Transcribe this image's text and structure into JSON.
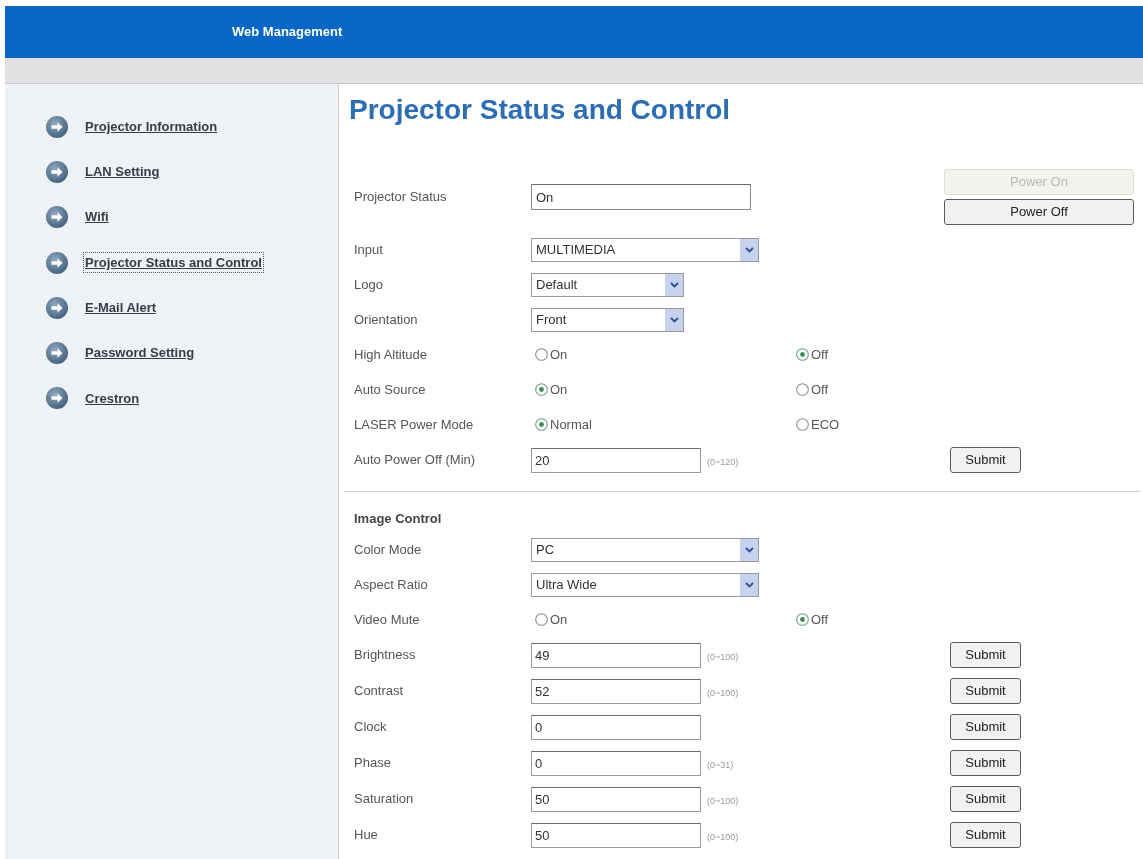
{
  "header": {
    "title": "Web Management"
  },
  "sidebar": {
    "items": [
      {
        "label": "Projector Information",
        "selected": false
      },
      {
        "label": "LAN Setting",
        "selected": false
      },
      {
        "label": "Wifi",
        "selected": false
      },
      {
        "label": "Projector Status and Control",
        "selected": true
      },
      {
        "label": "E-Mail Alert",
        "selected": false
      },
      {
        "label": "Password Setting",
        "selected": false
      },
      {
        "label": "Crestron",
        "selected": false
      }
    ]
  },
  "page_title": "Projector Status and Control",
  "sections": [
    {
      "rows": [
        {
          "kind": "status",
          "label": "Projector Status",
          "value": "On",
          "buttons": [
            {
              "label": "Power On",
              "disabled": true
            },
            {
              "label": "Power Off",
              "disabled": false
            }
          ]
        },
        {
          "kind": "select",
          "label": "Input",
          "value": "MULTIMEDIA"
        },
        {
          "kind": "select",
          "label": "Logo",
          "value": "Default"
        },
        {
          "kind": "select",
          "label": "Orientation",
          "value": "Front"
        },
        {
          "kind": "radio",
          "label": "High Altitude",
          "options": [
            {
              "label": "On",
              "selected": false
            },
            {
              "label": "Off",
              "selected": true
            }
          ]
        },
        {
          "kind": "radio",
          "label": "Auto Source",
          "options": [
            {
              "label": "On",
              "selected": true
            },
            {
              "label": "Off",
              "selected": false
            }
          ]
        },
        {
          "kind": "radio",
          "label": "LASER Power Mode",
          "options": [
            {
              "label": "Normal",
              "selected": true
            },
            {
              "label": "ECO",
              "selected": false
            }
          ]
        },
        {
          "kind": "number",
          "label": "Auto Power Off (Min)",
          "value": "20",
          "hint": "(0~120)",
          "button": "Submit"
        }
      ]
    },
    {
      "title": "Image Control",
      "rows": [
        {
          "kind": "select",
          "label": "Color Mode",
          "value": "PC"
        },
        {
          "kind": "select",
          "label": "Aspect Ratio",
          "value": "Ultra Wide"
        },
        {
          "kind": "radio",
          "label": "Video Mute",
          "options": [
            {
              "label": "On",
              "selected": false
            },
            {
              "label": "Off",
              "selected": true
            }
          ]
        },
        {
          "kind": "number",
          "label": "Brightness",
          "value": "49",
          "hint": "(0~100)",
          "button": "Submit"
        },
        {
          "kind": "number",
          "label": "Contrast",
          "value": "52",
          "hint": "(0~100)",
          "button": "Submit"
        },
        {
          "kind": "number",
          "label": "Clock",
          "value": "0",
          "button": "Submit"
        },
        {
          "kind": "number",
          "label": "Phase",
          "value": "0",
          "hint": "(0~31)",
          "button": "Submit"
        },
        {
          "kind": "number",
          "label": "Saturation",
          "value": "50",
          "hint": "(0~100)",
          "button": "Submit"
        },
        {
          "kind": "number",
          "label": "Hue",
          "value": "50",
          "hint": "(0~100)",
          "button": "Submit"
        }
      ]
    }
  ]
}
